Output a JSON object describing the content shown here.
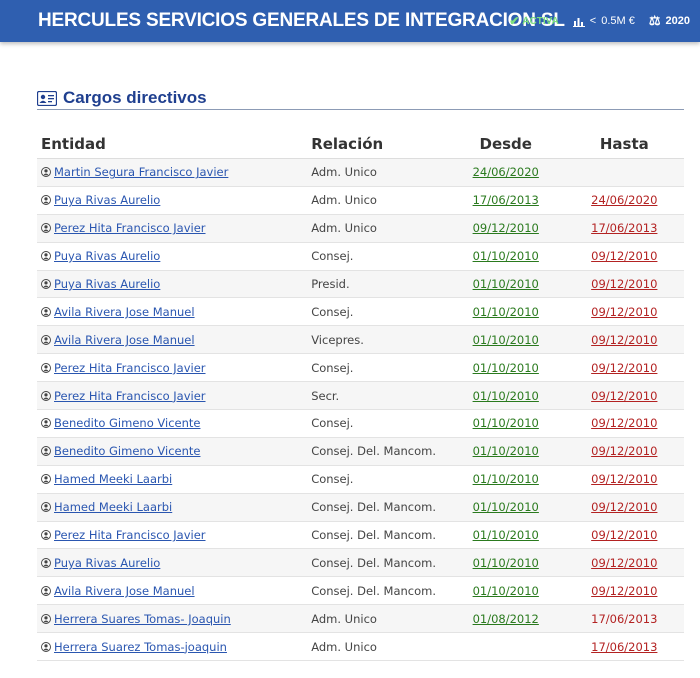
{
  "header": {
    "company": "HERCULES SERVICIOS GENERALES DE INTEGRACION SL",
    "status": "ACTIVA",
    "capital_prefix": "<",
    "capital": "0.5M €",
    "year": "2020"
  },
  "section": {
    "title": "Cargos directivos",
    "columns": [
      "Entidad",
      "Relación",
      "Desde",
      "Hasta"
    ]
  },
  "rows": [
    {
      "entity": "Martin Segura Francisco Javier",
      "relation": "Adm. Unico",
      "desde": "24/06/2020",
      "hasta": ""
    },
    {
      "entity": "Puya Rivas Aurelio",
      "relation": "Adm. Unico",
      "desde": "17/06/2013",
      "hasta": "24/06/2020"
    },
    {
      "entity": "Perez Hita Francisco Javier",
      "relation": "Adm. Unico",
      "desde": "09/12/2010",
      "hasta": "17/06/2013"
    },
    {
      "entity": "Puya Rivas Aurelio",
      "relation": "Consej.",
      "desde": "01/10/2010",
      "hasta": "09/12/2010"
    },
    {
      "entity": "Puya Rivas Aurelio",
      "relation": "Presid.",
      "desde": "01/10/2010",
      "hasta": "09/12/2010"
    },
    {
      "entity": "Avila Rivera Jose Manuel",
      "relation": "Consej.",
      "desde": "01/10/2010",
      "hasta": "09/12/2010"
    },
    {
      "entity": "Avila Rivera Jose Manuel",
      "relation": "Vicepres.",
      "desde": "01/10/2010",
      "hasta": "09/12/2010"
    },
    {
      "entity": "Perez Hita Francisco Javier",
      "relation": "Consej.",
      "desde": "01/10/2010",
      "hasta": "09/12/2010"
    },
    {
      "entity": "Perez Hita Francisco Javier",
      "relation": "Secr.",
      "desde": "01/10/2010",
      "hasta": "09/12/2010"
    },
    {
      "entity": "Benedito Gimeno Vicente",
      "relation": "Consej.",
      "desde": "01/10/2010",
      "hasta": "09/12/2010"
    },
    {
      "entity": "Benedito Gimeno Vicente",
      "relation": "Consej. Del. Mancom.",
      "desde": "01/10/2010",
      "hasta": "09/12/2010"
    },
    {
      "entity": "Hamed Meeki Laarbi",
      "relation": "Consej.",
      "desde": "01/10/2010",
      "hasta": "09/12/2010"
    },
    {
      "entity": "Hamed Meeki Laarbi",
      "relation": "Consej. Del. Mancom.",
      "desde": "01/10/2010",
      "hasta": "09/12/2010"
    },
    {
      "entity": "Perez Hita Francisco Javier",
      "relation": "Consej. Del. Mancom.",
      "desde": "01/10/2010",
      "hasta": "09/12/2010"
    },
    {
      "entity": "Puya Rivas Aurelio",
      "relation": "Consej. Del. Mancom.",
      "desde": "01/10/2010",
      "hasta": "09/12/2010"
    },
    {
      "entity": "Avila Rivera Jose Manuel",
      "relation": "Consej. Del. Mancom.",
      "desde": "01/10/2010",
      "hasta": "09/12/2010"
    },
    {
      "entity": "Herrera Suares Tomas- Joaquin",
      "relation": "Adm. Unico",
      "desde": "01/08/2012",
      "hasta": "17/06/2013"
    },
    {
      "entity": "Herrera Suarez Tomas-joaquin",
      "relation": "Adm. Unico",
      "desde": "",
      "hasta": "17/06/2013"
    }
  ],
  "colors": {
    "header_bg": "#2f5fb0",
    "status": "#7ee07e",
    "link": "#2a56b0",
    "desde": "#2a7a1e",
    "hasta": "#b32222"
  }
}
